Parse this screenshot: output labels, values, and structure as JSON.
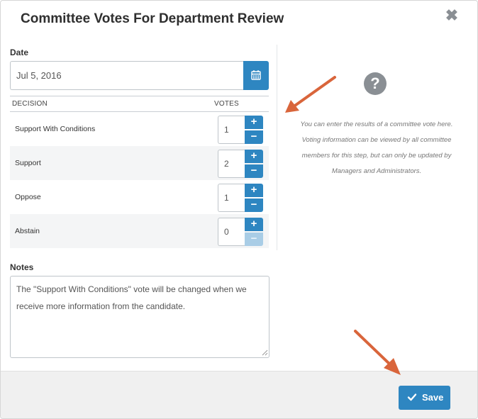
{
  "dialog": {
    "title": "Committee Votes For Department Review",
    "close_symbol": "✖"
  },
  "date": {
    "label": "Date",
    "value": "Jul 5, 2016",
    "button_icon": "calendar-icon"
  },
  "table": {
    "headers": {
      "decision": "DECISION",
      "votes": "VOTES"
    },
    "rows": [
      {
        "label": "Support With Conditions",
        "votes": "1",
        "minus_enabled": true
      },
      {
        "label": "Support",
        "votes": "2",
        "minus_enabled": true
      },
      {
        "label": "Oppose",
        "votes": "1",
        "minus_enabled": true
      },
      {
        "label": "Abstain",
        "votes": "0",
        "minus_enabled": false
      }
    ],
    "plus": "+",
    "minus": "−"
  },
  "help": {
    "icon": "question-icon",
    "text": "You can enter the results of a committee vote here. Voting information can be viewed by all committee members for this step, but can only be updated by Managers and Administrators."
  },
  "notes": {
    "label": "Notes",
    "value": "The \"Support With Conditions\" vote will be changed when we receive more information from the candidate."
  },
  "footer": {
    "save_label": "Save",
    "save_icon": "check-icon"
  },
  "colors": {
    "accent": "#2e86c1",
    "arrow": "#d9653b"
  }
}
